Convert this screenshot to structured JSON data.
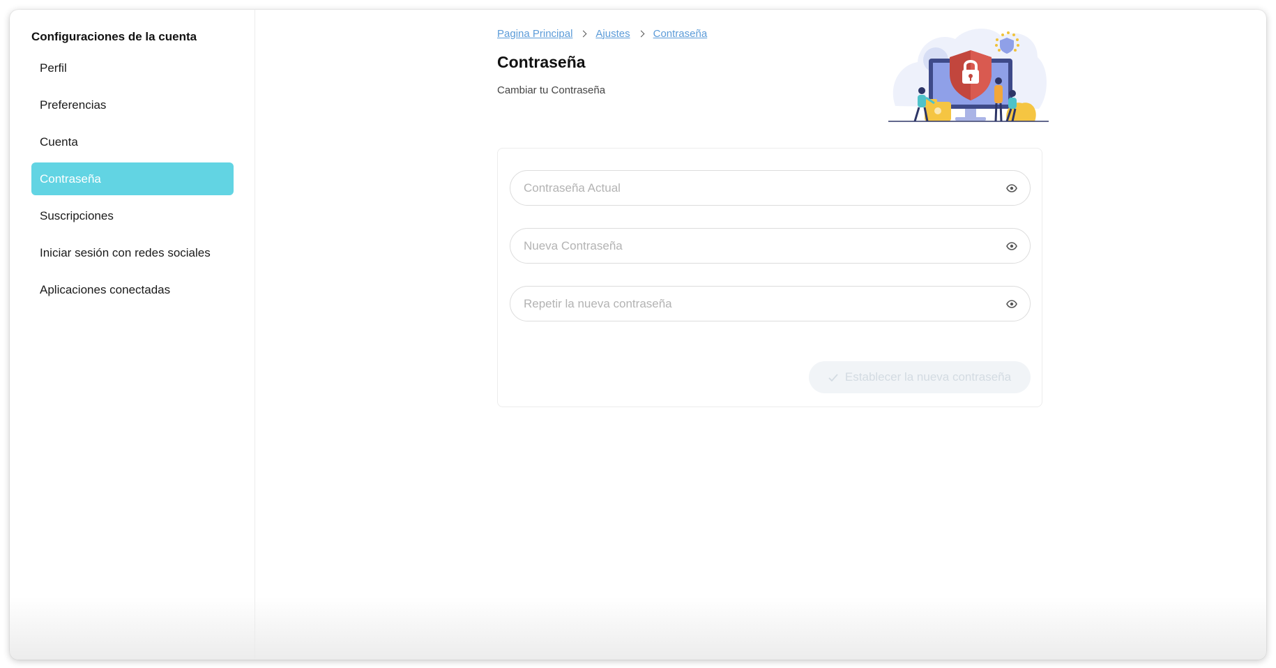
{
  "sidebar": {
    "title": "Configuraciones de la cuenta",
    "items": [
      {
        "label": "Perfil"
      },
      {
        "label": "Preferencias"
      },
      {
        "label": "Cuenta"
      },
      {
        "label": "Contraseña",
        "active": true
      },
      {
        "label": "Suscripciones"
      },
      {
        "label": "Iniciar sesión con redes sociales"
      },
      {
        "label": "Aplicaciones conectadas"
      }
    ]
  },
  "breadcrumb": {
    "items": [
      "Pagina Principal",
      "Ajustes",
      "Contraseña"
    ]
  },
  "header": {
    "title": "Contraseña",
    "subtitle": "Cambiar tu Contraseña"
  },
  "form": {
    "current_password": {
      "placeholder": "Contraseña Actual",
      "value": ""
    },
    "new_password": {
      "placeholder": "Nueva Contraseña",
      "value": ""
    },
    "repeat_password": {
      "placeholder": "Repetir la nueva contraseña",
      "value": ""
    },
    "submit_label": "Establecer la nueva contraseña"
  },
  "colors": {
    "accent": "#62d4e3",
    "link": "#5b9bd8",
    "button_disabled_bg": "#f1f4f7"
  },
  "icons": {
    "field_toggle": "eye-icon",
    "breadcrumb_separator": "chevron-right-icon",
    "submit": "check-icon",
    "illustration": "security-shield-illustration"
  }
}
